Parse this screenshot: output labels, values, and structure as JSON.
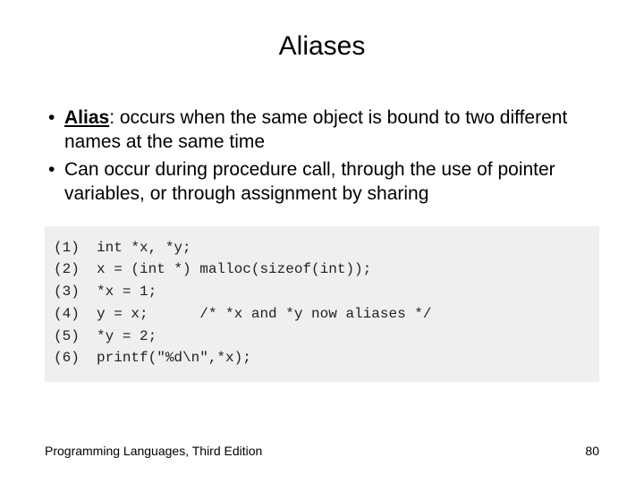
{
  "title": "Aliases",
  "bullets": [
    {
      "term": "Alias",
      "text": ": occurs when the same object is bound to two different names at the same time"
    },
    {
      "term": "",
      "text": "Can occur during procedure call, through the use of pointer variables, or through assignment by sharing"
    }
  ],
  "code": {
    "l1": "(1)  int *x, *y;",
    "l2": "(2)  x = (int *) malloc(sizeof(int));",
    "l3": "(3)  *x = 1;",
    "l4": "(4)  y = x;      /* *x and *y now aliases */",
    "l5": "(5)  *y = 2;",
    "l6": "(6)  printf(\"%d\\n\",*x);"
  },
  "footer": {
    "left": "Programming Languages, Third Edition",
    "right": "80"
  }
}
